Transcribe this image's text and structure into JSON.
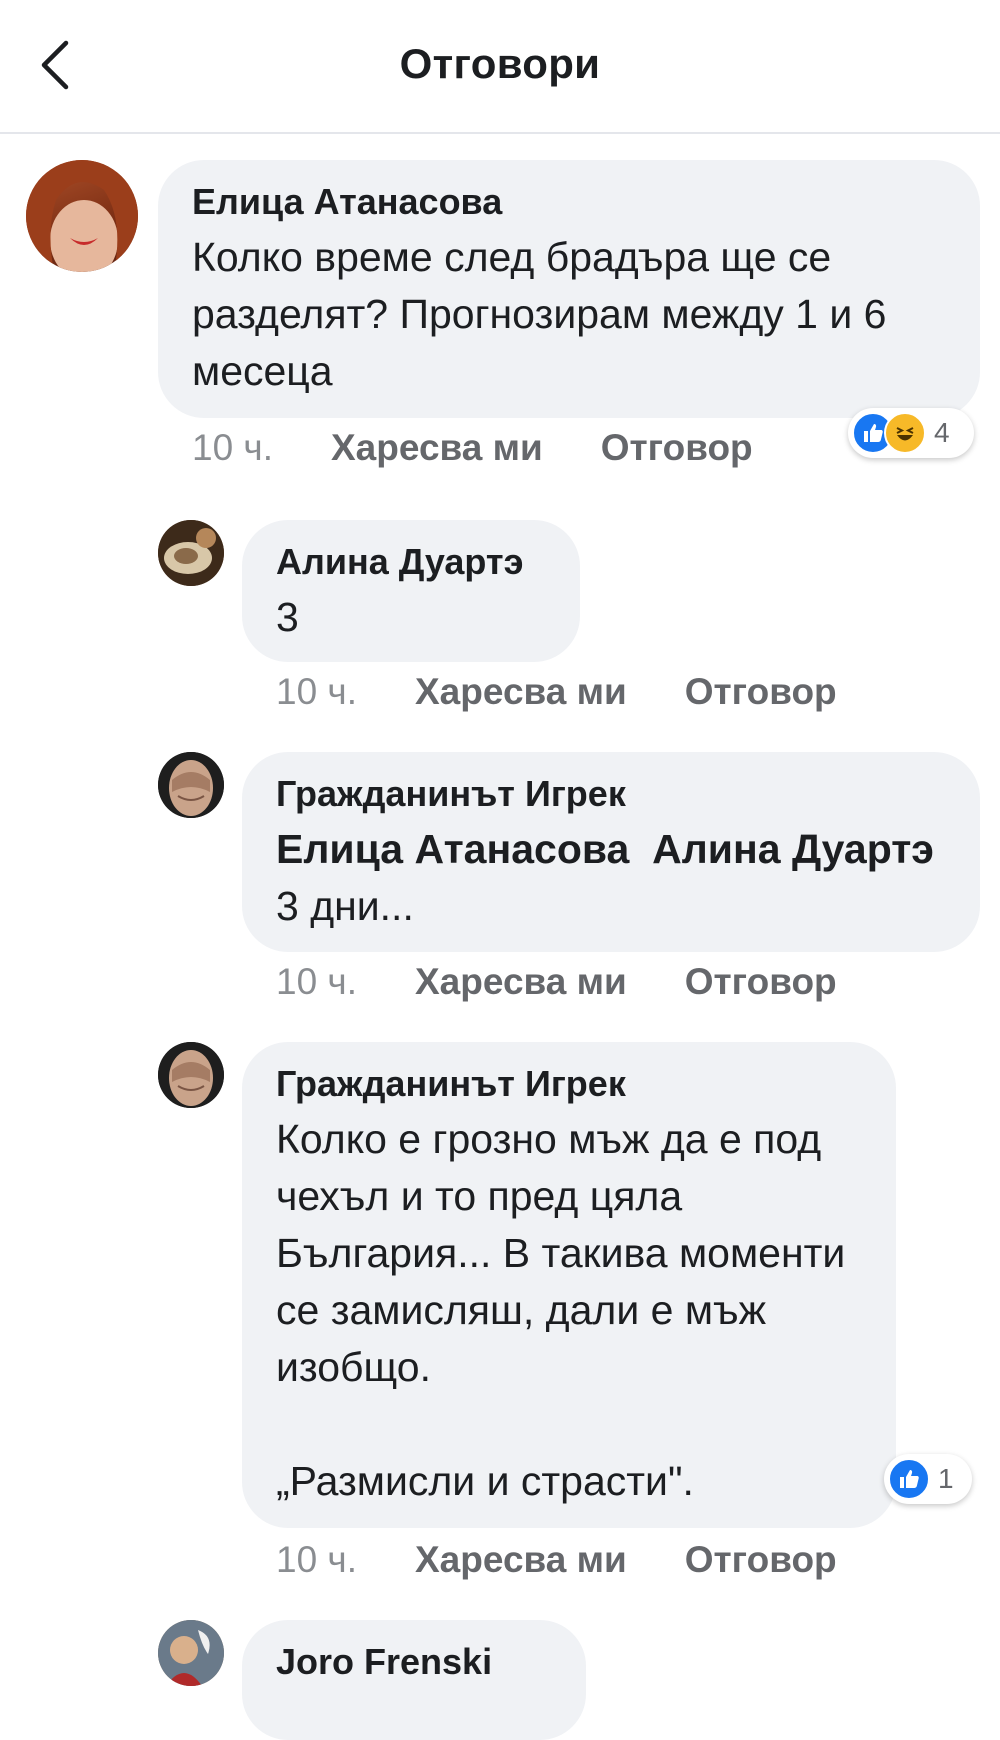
{
  "header": {
    "title": "Отговори",
    "back_icon": "chevron-left-icon"
  },
  "comments": [
    {
      "author": "Елица Атанасова",
      "text": "Колко време след брадъра ще се разделят? Прогнозирам между 1 и 6 месеца",
      "time": "10 ч.",
      "like_label": "Харесва ми",
      "reply_label": "Отговор",
      "reactions": {
        "icons": [
          "like-icon",
          "haha-icon"
        ],
        "count": "4"
      }
    },
    {
      "author": "Алина Дуартэ",
      "text": "3",
      "time": "10 ч.",
      "like_label": "Харесва ми",
      "reply_label": "Отговор"
    },
    {
      "author": "Гражданинът Игрек",
      "mention1": "Елица Атанасова",
      "mention2": "Алина Дуартэ",
      "text": "3 дни...",
      "time": "10 ч.",
      "like_label": "Харесва ми",
      "reply_label": "Отговор"
    },
    {
      "author": "Гражданинът Игрек",
      "text1": "Колко е грозно мъж да е под чехъл и то пред цяла България... В такива моменти се замисляш, дали е мъж изобщо.",
      "text2": "„Размисли и страсти\".",
      "time": "10 ч.",
      "like_label": "Харесва ми",
      "reply_label": "Отговор",
      "reactions": {
        "icons": [
          "like-icon"
        ],
        "count": "1"
      }
    },
    {
      "author": "Joro Frenski"
    }
  ],
  "colors": {
    "like_blue": "#1877f2",
    "haha_yellow": "#f7b928",
    "bubble_gray": "#f0f2f5"
  }
}
